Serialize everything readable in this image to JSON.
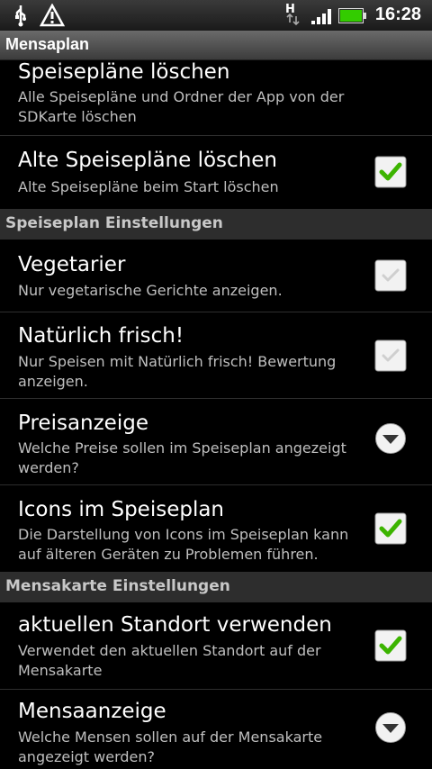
{
  "statusbar": {
    "network_type": "H",
    "time": "16:28",
    "icons": [
      "usb-icon",
      "warning-icon",
      "network-h-icon",
      "signal-icon",
      "battery-icon"
    ],
    "battery_color": "#33cc00"
  },
  "app": {
    "title": "Mensaplan"
  },
  "list": {
    "items": [
      {
        "title": "Speisepläne löschen",
        "summary": "Alle Speisepläne und Ordner der App von der SDKarte löschen"
      },
      {
        "title": "Alte Speisepläne löschen",
        "summary": "Alte Speisepläne beim Start löschen",
        "checked": true
      },
      {
        "title": "Vegetarier",
        "summary": "Nur vegetarische Gerichte anzeigen.",
        "checked": false
      },
      {
        "title": "Natürlich frisch!",
        "summary": "Nur Speisen mit Natürlich frisch! Bewertung anzeigen.",
        "checked": false
      },
      {
        "title": "Preisanzeige",
        "summary": "Welche Preise sollen im Speiseplan angezeigt werden?",
        "control": "dropdown"
      },
      {
        "title": "Icons im Speiseplan",
        "summary": "Die Darstellung von Icons im Speiseplan kann auf älteren Geräten zu Problemen führen.",
        "checked": true
      },
      {
        "title": "aktuellen Standort verwenden",
        "summary": "Verwendet den aktuellen Standort auf der Mensakarte",
        "checked": true
      },
      {
        "title": "Mensaanzeige",
        "summary": "Welche Mensen sollen auf der Mensakarte angezeigt werden?",
        "control": "dropdown"
      }
    ],
    "headers": [
      "Speiseplan Einstellungen",
      "Mensakarte Einstellungen"
    ]
  },
  "colors": {
    "check_green": "#3cb400",
    "accent_header_bg": "#2d2d2d"
  }
}
